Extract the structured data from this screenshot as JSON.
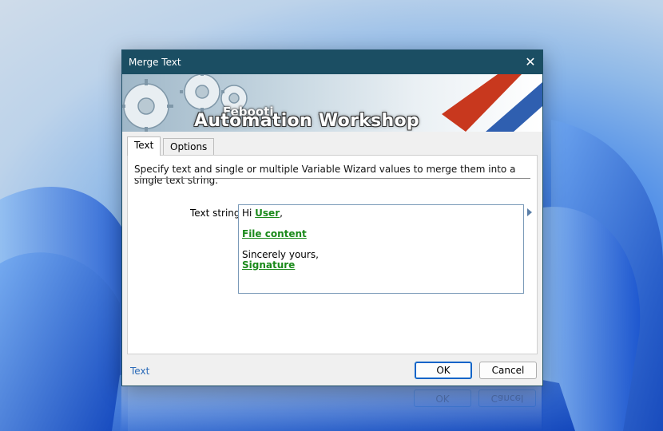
{
  "window": {
    "title": "Merge Text",
    "close_glyph": "✕"
  },
  "banner": {
    "brand_small": "Febooti",
    "brand_big": "Automation Workshop"
  },
  "tabs": [
    {
      "label": "Text",
      "active": true
    },
    {
      "label": "Options",
      "active": false
    }
  ],
  "description": "Specify text and single or multiple Variable Wizard values to merge them into a single text string.",
  "field": {
    "label": "Text string:",
    "lines": {
      "l1_prefix": "Hi ",
      "l1_var": "User",
      "l1_suffix": ",",
      "l2_var": "File content",
      "l3_text": "Sincerely yours,",
      "l4_var": "Signature"
    }
  },
  "footer": {
    "help_link": "Text",
    "ok_label": "OK",
    "cancel_label": "Cancel"
  },
  "colors": {
    "titlebar": "#1b4e63",
    "variable_green": "#1b8a1b",
    "link_blue": "#2a6ab8",
    "default_button_border": "#0a64c8"
  },
  "icons": {
    "close": "close-icon",
    "expand": "expand-arrow-icon"
  }
}
